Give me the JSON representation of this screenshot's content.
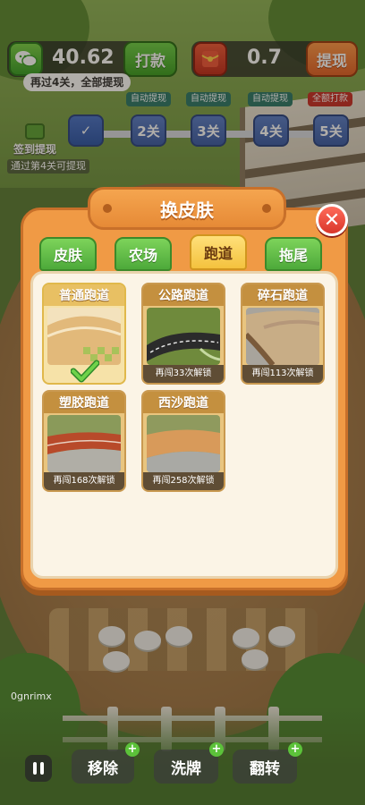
{
  "hud": {
    "cash_value": "40.62",
    "cash_button": "打款",
    "redpack_value": "0.7",
    "redpack_button": "提现",
    "tip": "再过4关，全部提现"
  },
  "progress": {
    "signin_label": "签到提现",
    "note": "通过第4关可提现",
    "levels": [
      {
        "tag": "",
        "label": "✓"
      },
      {
        "tag": "自动提现",
        "label": "2关"
      },
      {
        "tag": "自动提现",
        "label": "3关"
      },
      {
        "tag": "自动提现",
        "label": "4关"
      },
      {
        "tag": "全额打款",
        "label": "5关"
      }
    ]
  },
  "modal": {
    "title": "换皮肤",
    "close": "✕",
    "tabs": [
      {
        "label": "皮肤",
        "active": false
      },
      {
        "label": "农场",
        "active": false
      },
      {
        "label": "跑道",
        "active": true
      },
      {
        "label": "拖尾",
        "active": false
      }
    ],
    "cards": [
      {
        "title": "普通跑道",
        "status": "",
        "selected": true
      },
      {
        "title": "公路跑道",
        "status": "再闯33次解锁",
        "selected": false
      },
      {
        "title": "碎石跑道",
        "status": "再闯113次解锁",
        "selected": false
      },
      {
        "title": "塑胶跑道",
        "status": "再闯168次解锁",
        "selected": false
      },
      {
        "title": "西沙跑道",
        "status": "再闯258次解锁",
        "selected": false
      }
    ]
  },
  "bottom": {
    "remove": "移除",
    "shuffle": "洗牌",
    "flip": "翻转",
    "watermark": "0gnrimx"
  },
  "colors": {
    "accent_orange": "#f09a45",
    "tab_green": "#5dbb42",
    "tab_active": "#f4c23e",
    "close_red": "#e0412f"
  }
}
